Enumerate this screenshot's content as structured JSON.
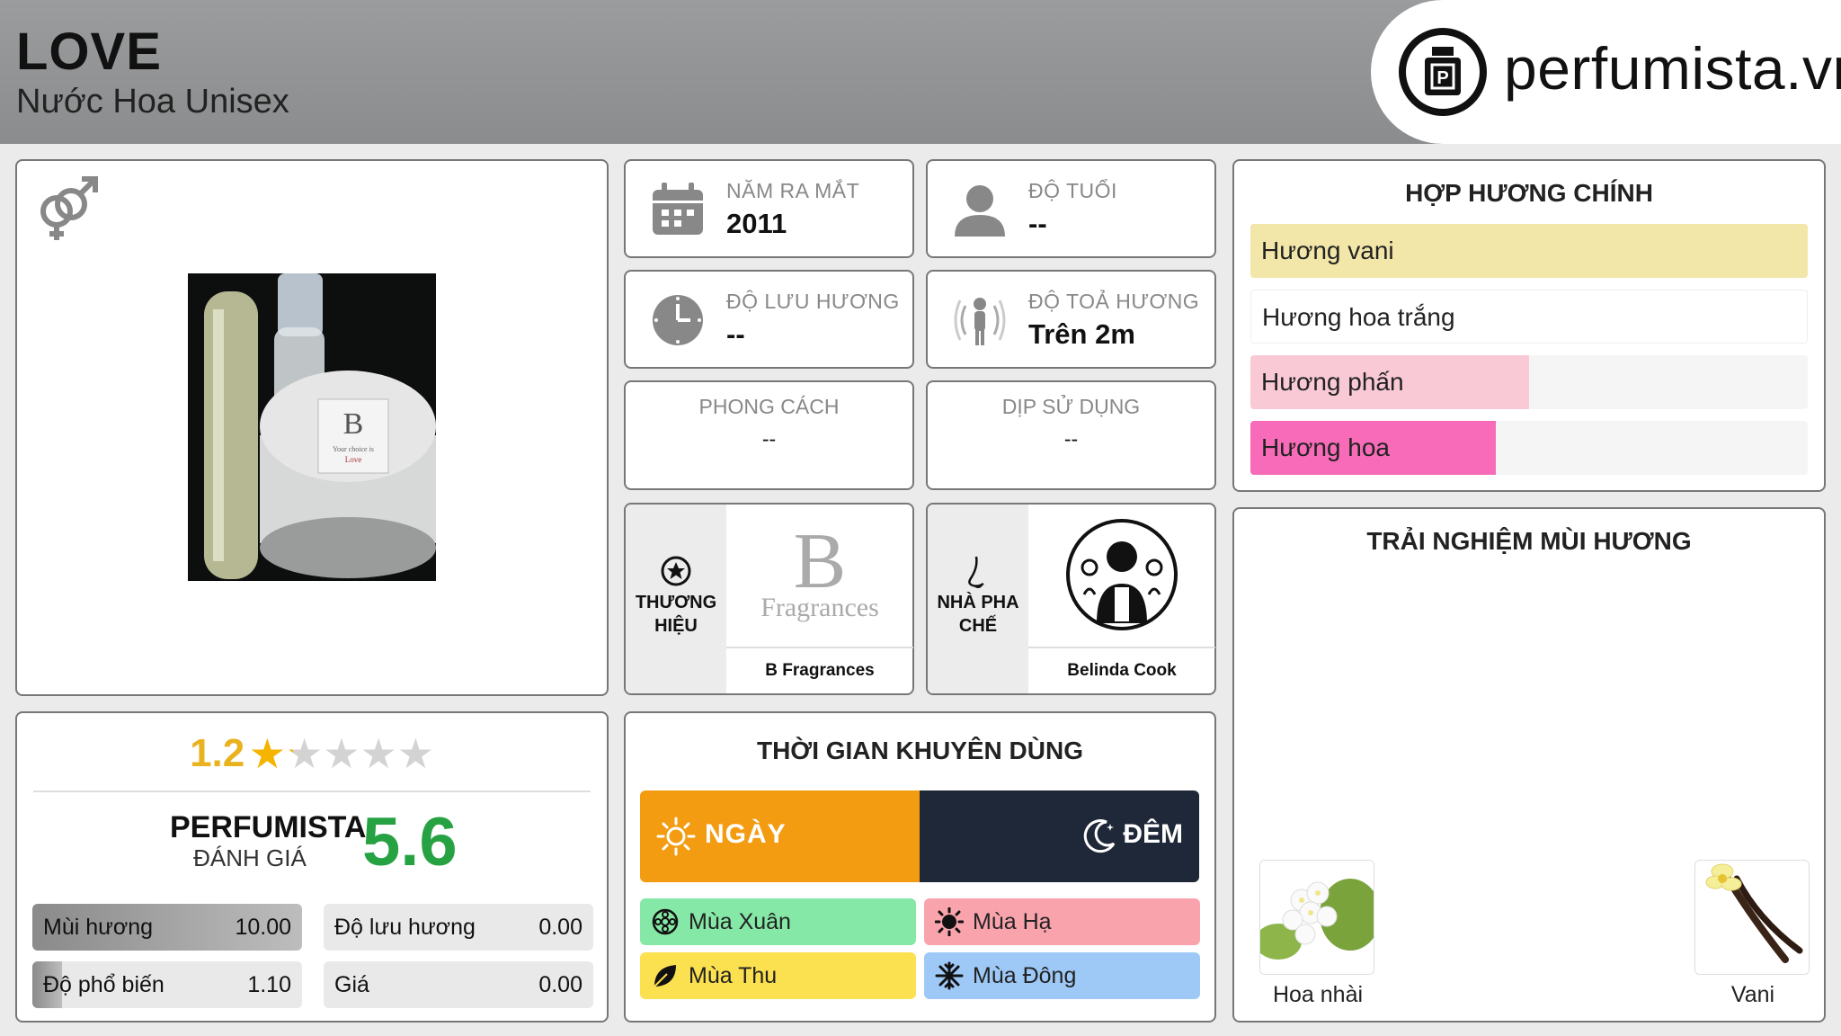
{
  "header": {
    "title": "LOVE",
    "subtitle": "Nước Hoa Unisex",
    "logo_text": "perfumista.vn"
  },
  "product": {
    "gender_icon": "unisex-gender-icon",
    "image_label_letter": "B",
    "image_label_line1": "Your choice is",
    "image_label_line2": "Love"
  },
  "rating": {
    "value": "1.2",
    "stars_filled_fraction": 0.24,
    "perfumista_label": "PERFUMISTA",
    "perfumista_sub": "ĐÁNH GIÁ",
    "perfumista_score": "5.6",
    "metrics": [
      {
        "label": "Mùi hương",
        "value": "10.00",
        "fraction": 1.0
      },
      {
        "label": "Độ lưu hương",
        "value": "0.00",
        "fraction": 0.0
      },
      {
        "label": "Độ phổ biến",
        "value": "1.10",
        "fraction": 0.11
      },
      {
        "label": "Giá",
        "value": "0.00",
        "fraction": 0.0
      }
    ]
  },
  "info": {
    "release": {
      "label": "NĂM RA MẮT",
      "value": "2011",
      "icon": "calendar-icon"
    },
    "age": {
      "label": "ĐỘ TUỔI",
      "value": "--",
      "icon": "person-icon"
    },
    "longevity": {
      "label": "ĐỘ LƯU HƯƠNG",
      "value": "--",
      "icon": "clock-icon"
    },
    "sillage": {
      "label": "ĐỘ TOẢ HƯƠNG",
      "value": "Trên 2m",
      "icon": "sillage-icon"
    },
    "style": {
      "label": "PHONG CÁCH",
      "value": "--"
    },
    "occasion": {
      "label": "DỊP SỬ DỤNG",
      "value": "--"
    },
    "brand": {
      "side_label_1": "THƯƠNG",
      "side_label_2": "HIỆU",
      "logo_letter": "B",
      "logo_word": "Fragrances",
      "name": "B Fragrances"
    },
    "perfumer": {
      "side_label_1": "NHÀ PHA",
      "side_label_2": "CHẾ",
      "name": "Belinda Cook"
    }
  },
  "accords": {
    "heading": "HỢP HƯƠNG CHÍNH",
    "items": [
      {
        "label": "Hương vani",
        "fraction": 1.0,
        "color": "#f2e6a8"
      },
      {
        "label": "Hương hoa trắng",
        "fraction": 1.0,
        "color": "#ffffff"
      },
      {
        "label": "Hương phấn",
        "fraction": 0.5,
        "color": "#f9c9d6"
      },
      {
        "label": "Hương hoa",
        "fraction": 0.44,
        "color": "#f76bb8"
      }
    ]
  },
  "time": {
    "heading": "THỜI GIAN KHUYÊN DÙNG",
    "day": "NGÀY",
    "night": "ĐÊM",
    "seasons": [
      {
        "label": "Mùa Xuân",
        "color": "#86e8a6",
        "icon": "spring-icon"
      },
      {
        "label": "Mùa Hạ",
        "color": "#f9a3ad",
        "icon": "summer-icon"
      },
      {
        "label": "Mùa Thu",
        "color": "#fbe04f",
        "icon": "autumn-icon"
      },
      {
        "label": "Mùa Đông",
        "color": "#9ec9f7",
        "icon": "winter-icon"
      }
    ]
  },
  "experience": {
    "heading": "TRẢI NGHIỆM MÙI HƯƠNG",
    "notes": [
      {
        "label": "Hoa nhài"
      },
      {
        "label": "Vani"
      }
    ]
  }
}
